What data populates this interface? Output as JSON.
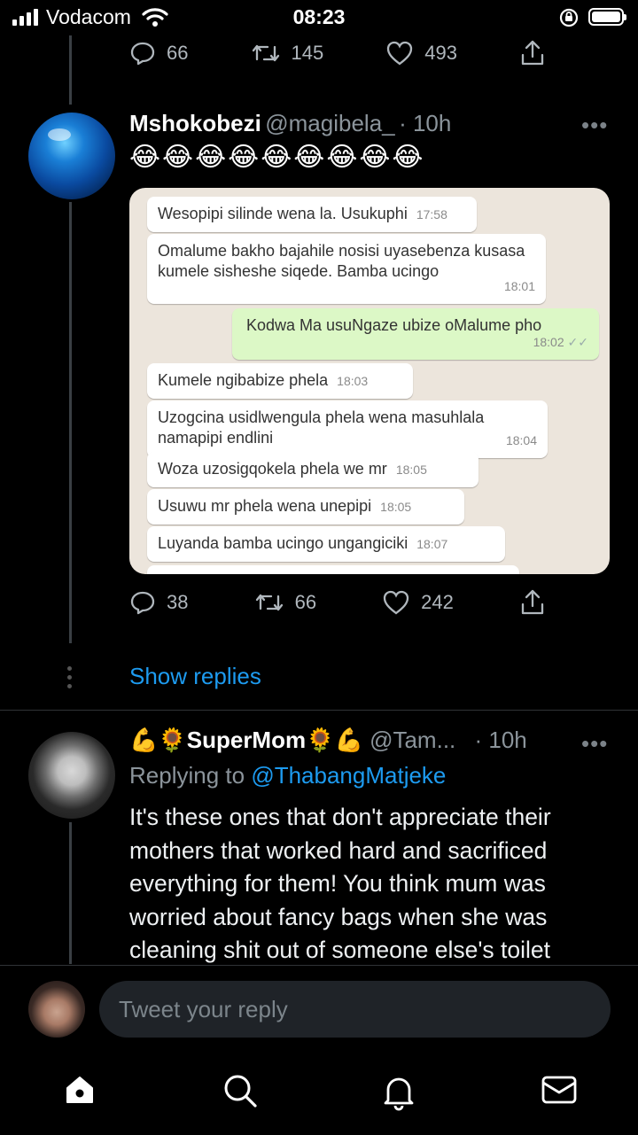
{
  "status_bar": {
    "carrier": "Vodacom",
    "time": "08:23"
  },
  "prev_tweet_actions": {
    "replies": "66",
    "retweets": "145",
    "likes": "493"
  },
  "tweet1": {
    "display_name": "Mshokobezi",
    "handle": "@magibela_",
    "time": "· 10h",
    "text": "😂😂😂😂😂😂😂😂😂",
    "actions": {
      "replies": "38",
      "retweets": "66",
      "likes": "242"
    }
  },
  "chat": {
    "messages": [
      {
        "text": "Wesopipi silinde wena la. Usukuphi",
        "time": "17:58",
        "dir": "in"
      },
      {
        "text": "Omalume bakho bajahile nosisi uyasebenza kusasa kumele sisheshe siqede. Bamba ucingo",
        "time": "18:01",
        "dir": "in"
      },
      {
        "text": "Kodwa Ma usuNgaze ubize oMalume pho",
        "time": "18:02",
        "dir": "out"
      },
      {
        "text": "Kumele ngibabize phela",
        "time": "18:03",
        "dir": "in"
      },
      {
        "text": "Uzogcina usidlwengula phela wena masuhlala namapipi endlini",
        "time": "18:04",
        "dir": "in"
      },
      {
        "text": "Woza uzosigqokela phela we mr",
        "time": "18:05",
        "dir": "in"
      },
      {
        "text": "Usuwu mr phela wena unepipi",
        "time": "18:05",
        "dir": "in"
      },
      {
        "text": "Luyanda bamba ucingo ungangiciki",
        "time": "18:07",
        "dir": "in"
      }
    ]
  },
  "show_replies": "Show replies",
  "tweet2": {
    "emoji_prefix": "💪🌻",
    "display_name": "SuperMom",
    "emoji_suffix": "🌻💪",
    "handle": "@Tam...",
    "time": "· 10h",
    "replying_label": "Replying to",
    "replying_handle": "@ThabangMatjeke",
    "text": "It's these ones that don't appreciate their mothers that worked hard and sacrificed everything for them! You think mum was worried about fancy bags when she was cleaning shit out of someone else's toilet"
  },
  "reply_box": {
    "placeholder": "Tweet your reply"
  },
  "colors": {
    "accent": "#1d9bf0",
    "background": "#000000",
    "muted": "#8b949b"
  },
  "nav_icons": [
    "home-icon",
    "search-icon",
    "notifications-icon",
    "messages-icon"
  ]
}
